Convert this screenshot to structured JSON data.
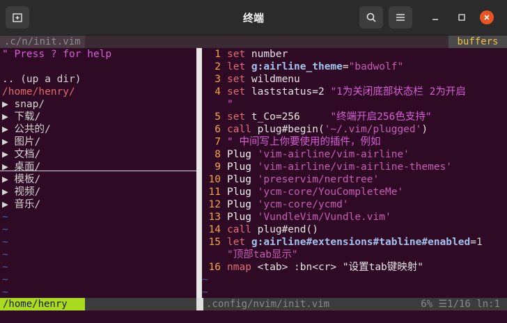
{
  "window": {
    "title": "终端"
  },
  "tabline": {
    "file": ".c/n/init.vim",
    "buffers": "buffers"
  },
  "tree": {
    "help": "\" Press ? for help",
    "updir": ".. (up a dir)",
    "root": "/home/henry/",
    "items": [
      "snap/",
      "下载/",
      "公共的/",
      "图片/",
      "文档/",
      "桌面/",
      "模板/",
      "视频/",
      "音乐/"
    ]
  },
  "editor": {
    "lines": [
      {
        "n": "1",
        "kw": "set",
        "rest": " number"
      },
      {
        "n": "2",
        "kw": "let",
        "v": " g:airline_theme",
        "eq": "=",
        "s": "\"badwolf\""
      },
      {
        "n": "3",
        "kw": "set",
        "rest": " wildmenu"
      },
      {
        "n": "4",
        "kw": "set",
        "rest": " laststatus=2",
        "c": " \"1为关闭底部状态栏 2为开启"
      },
      {
        "n": "",
        "c": "\""
      },
      {
        "n": "5",
        "kw": "set",
        "p": " t_Co=256     ",
        "c": "\"终端开启256色支持\""
      },
      {
        "n": "6",
        "kw": "call",
        "p": " plug#begin(",
        "s": "'~/.vim/plugged'",
        "p2": ")"
      },
      {
        "n": "7",
        "c": "\" 中间写上你要使用的插件，例如"
      },
      {
        "n": "8",
        "pl": "Plug ",
        "s": "'vim-airline/vim-airline'"
      },
      {
        "n": "9",
        "pl": "Plug ",
        "s": "'vim-airline/vim-airline-themes'"
      },
      {
        "n": "10",
        "pl": "Plug ",
        "s": "'preservim/nerdtree'"
      },
      {
        "n": "11",
        "pl": "Plug ",
        "s": "'ycm-core/YouCompleteMe'"
      },
      {
        "n": "12",
        "pl": "Plug ",
        "s": "'ycm-core/ycmd'"
      },
      {
        "n": "13",
        "pl": "Plug ",
        "s": "'VundleVim/Vundle.vim'"
      },
      {
        "n": "14",
        "kw": "call",
        "p": " plug#end()"
      },
      {
        "n": "15",
        "kw": "let",
        "v2": " g:airline#extensions#tabline#enabled",
        "eq": "=",
        "nm": "1"
      },
      {
        "n": "",
        "s": "\"顶部tab显示\""
      },
      {
        "n": "16",
        "kw": "nmap",
        "p": " <tab> :bn<cr> \"设置tab键映射\""
      }
    ]
  },
  "status": {
    "left": "/home/henry",
    "mid": ".config/nvim/init.vim",
    "right": "6% ☰1/16 ln:1"
  },
  "tilde": "~"
}
